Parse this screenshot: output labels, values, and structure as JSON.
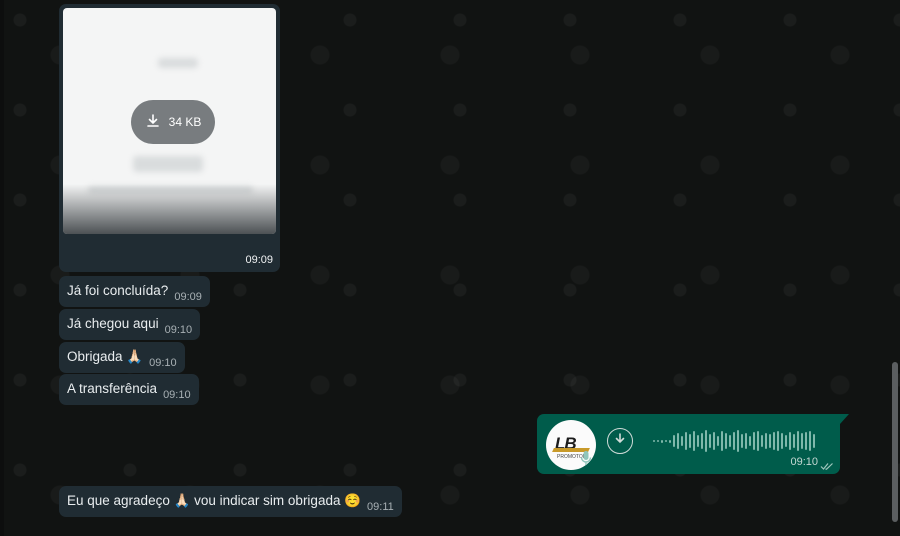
{
  "chat": {
    "image_message": {
      "size_label": "34 KB",
      "time": "09:09"
    },
    "incoming_messages": [
      {
        "text": "Já foi concluída?",
        "time": "09:09"
      },
      {
        "text": "Já chegou aqui",
        "time": "09:10"
      },
      {
        "text": "Obrigada 🙏🏻",
        "time": "09:10"
      },
      {
        "text": "A transferência",
        "time": "09:10"
      },
      {
        "text": "Eu que agradeço 🙏🏻 vou indicar sim obrigada ☺️",
        "time": "09:11"
      }
    ],
    "voice_message": {
      "time": "09:10",
      "avatar_logo_text": "LB",
      "avatar_sub_text": "PROMOTOR",
      "status": "delivered",
      "icon": "double-check-icon"
    }
  },
  "colors": {
    "incoming_bubble": "#202c33",
    "outgoing_bubble": "#005c4b",
    "background": "#111312"
  }
}
